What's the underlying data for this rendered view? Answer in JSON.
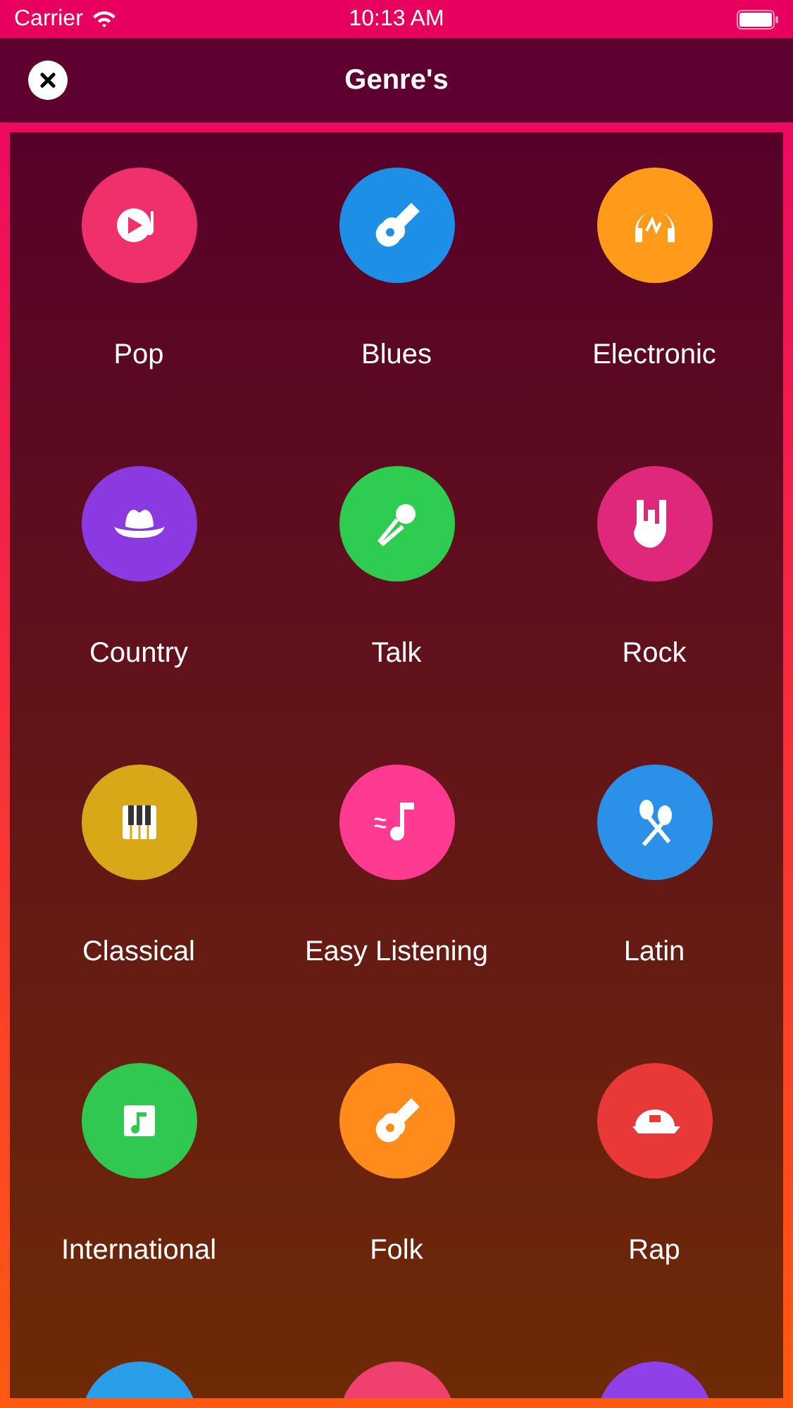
{
  "status_bar": {
    "carrier": "Carrier",
    "time": "10:13 AM"
  },
  "nav": {
    "title": "Genre's"
  },
  "genres": [
    {
      "name": "Pop",
      "color": "#f0306a"
    },
    {
      "name": "Blues",
      "color": "#1e8fe6"
    },
    {
      "name": "Electronic",
      "color": "#ff9a1a"
    },
    {
      "name": "Country",
      "color": "#8a3ae0"
    },
    {
      "name": "Talk",
      "color": "#2ecc50"
    },
    {
      "name": "Rock",
      "color": "#e0287a"
    },
    {
      "name": "Classical",
      "color": "#d8a818"
    },
    {
      "name": "Easy Listening",
      "color": "#ff3a90"
    },
    {
      "name": "Latin",
      "color": "#2a90e8"
    },
    {
      "name": "International",
      "color": "#30c850"
    },
    {
      "name": "Folk",
      "color": "#ff8c1a"
    },
    {
      "name": "Rap",
      "color": "#e83838"
    },
    {
      "color": "#2a9ee8"
    },
    {
      "color": "#f04070"
    },
    {
      "color": "#9040e8"
    }
  ]
}
